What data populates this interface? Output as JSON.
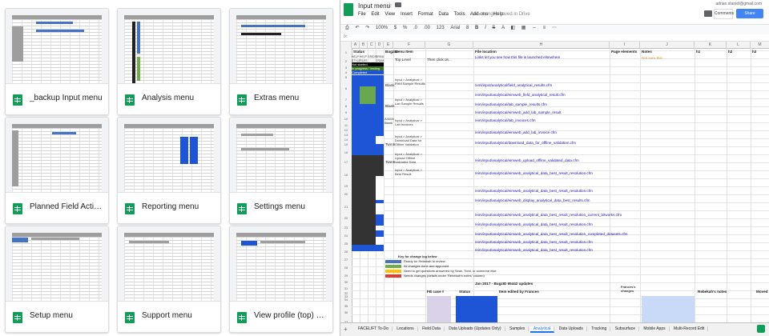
{
  "drive": {
    "files": [
      {
        "name": "_backup Input menu"
      },
      {
        "name": "Analysis menu"
      },
      {
        "name": "Extras menu"
      },
      {
        "name": "Planned Field Activit..."
      },
      {
        "name": "Reporting menu"
      },
      {
        "name": "Settings menu"
      },
      {
        "name": "Setup menu"
      },
      {
        "name": "Support menu"
      },
      {
        "name": "View profile (top) m..."
      }
    ]
  },
  "sheet": {
    "title": "Input menu",
    "account_email": "adrian.staniel@gmail.com",
    "saved_status": "All changes saved in Drive",
    "comments_label": "Comments",
    "share_label": "Share",
    "menu": [
      "File",
      "Edit",
      "View",
      "Insert",
      "Format",
      "Data",
      "Tools",
      "Add-ons",
      "Help"
    ],
    "toolbar": [
      "100%",
      "$",
      "%",
      ".0",
      ".00",
      "123",
      "Arial",
      "8",
      "B",
      "I",
      "S",
      "A"
    ],
    "columns": [
      "A",
      "B",
      "C",
      "D",
      "E",
      "F",
      "G",
      "H",
      "I",
      "J",
      "K",
      "L",
      "M"
    ],
    "row_numbers": [
      "1",
      "2",
      "3",
      "4",
      "5",
      "6",
      "7",
      "8",
      "9",
      "10",
      "11",
      "12",
      "13",
      "14",
      "15",
      "16",
      "17",
      "18",
      "19",
      "20",
      "21",
      "22",
      "23",
      "24",
      "25",
      "26",
      "27",
      "28",
      "29",
      "30",
      "31",
      "32",
      "33",
      "34",
      "35",
      "36",
      "37"
    ],
    "headers": {
      "status": "Status",
      "bugzid": "BugzID",
      "menu_item": "Menu Item",
      "file_location": "File location",
      "page_elements": "Page elements",
      "notes": "Notes",
      "h1": "h1",
      "h2": "h2",
      "h3": "h3",
      "help_styles": "HELP STYLES",
      "help_files": "HELP FILES",
      "grids": "GRIDS",
      "breadcrumb": "BREAD-CRUMB",
      "top_level": "Top Level",
      "then_click": "Then click on..."
    },
    "status_labels": {
      "not_started": "Not started",
      "in_progress": "In progress / testing",
      "completed": "Completed"
    },
    "menu_items": [
      "Input > Analytical > Field Sample Results",
      "Input > Analytical > Lab Sample Results",
      "Input > Analytical > Lab Invoices",
      "Input > Analytical > Download Data for Offline Validation",
      "Input > Analytical > Upload Offline Validated Data",
      "Input > Analytical > Best Result"
    ],
    "bugz_ids": [
      "Blank",
      "Blank",
      "A4008 Blank",
      "Twm5",
      "Twm5"
    ],
    "file_locations": [
      "/xml/input/analytical/field_analytical_results.cfm",
      "/eim/input/analytical/eimweb_field_analytical_result.cfm",
      "/eim/input/analytical/lab_sample_results.cfm",
      "/eim/input/analytical/eimweb_add_lab_sample_result",
      "/eim/input/analytical/lab_invoices.cfm",
      "/eim/input/analytical/eimweb_add_lab_invoice.cfm",
      "/eim/input/analytical/download_data_for_offline_validation.cfm",
      "/eim/input/analytical/eimweb_upload_offline_validated_data.cfm",
      "/eim/input/analytical/eimweb_analytical_data_best_result_resolution.cfm",
      "/eim/input/analytical/eimweb_analytical_data_best_result_resolution.cfm",
      "/eim/input/analytical/eimweb_display_analytical_data_best_results.cfm",
      "/eim/input/analytical/eimweb_analytical_data_best_result_resolution_current_bitworks.cfm",
      "/eim/input/analytical/eimweb_analytical_data_best_result_resolution.cfm",
      "/eim/input/analytical/eimweb_analytical_data_best_result_resolution_completed_datasets.cfm",
      "/eim/input/analytical/eimweb_analytical_data_best_result_resolution.cfm",
      "/eim/input/analytical/eimweb_analytical_data_best_result_resolution.cfm"
    ],
    "top_note": "Links let you see how this file is launched elsewhere",
    "notes_heading": "Not sure this",
    "key_title": "Key for change log below",
    "key_items": [
      {
        "label": "Ready for Rebekah to review",
        "color": "#4472c4"
      },
      {
        "label": "All changes done and approved",
        "color": "#70ad47"
      },
      {
        "label": "Need to get questions answered by Sean, Tomi, or someone else",
        "color": "#ffc000"
      },
      {
        "label": "Needs changes (details under 'Rebekah's notes' column)",
        "color": "#e53935"
      }
    ],
    "update_heading": "Jan 2017 - BugzID 65442 updates",
    "bottom_headers": {
      "fb_case": "FB case #",
      "status": "Status",
      "item_edited": "Item edited by Frances",
      "frances_changes": "Frances's changes",
      "rebekah_notes": "Rebekah's notes",
      "more": "Moved"
    }
  },
  "tabs": [
    "FACELIFT To-Do",
    "Locations",
    "Field Data",
    "Data Uploads (Updates Only)",
    "Samples",
    "Analytical",
    "Data Uploads",
    "Tracking",
    "Subsurface",
    "Mobile Apps",
    "Multi-Record Edit"
  ],
  "active_tab": "Analytical"
}
